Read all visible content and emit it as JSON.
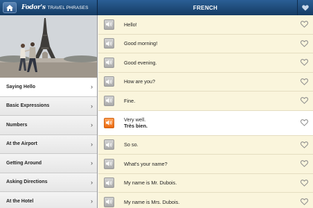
{
  "header": {
    "brand_logo": "Fodor's",
    "brand_sub": "TRAVEL PHRASES",
    "title": "FRENCH",
    "home_icon": "home-icon",
    "favorites_icon": "heart-icon"
  },
  "sidebar": {
    "categories": [
      {
        "label": "Saying Hello",
        "active": true
      },
      {
        "label": "Basic Expressions",
        "active": false
      },
      {
        "label": "Numbers",
        "active": false
      },
      {
        "label": "At the Airport",
        "active": false
      },
      {
        "label": "Getting Around",
        "active": false
      },
      {
        "label": "Asking Directions",
        "active": false
      },
      {
        "label": "At the Hotel",
        "active": false
      }
    ]
  },
  "phrases": [
    {
      "text": "Hello!",
      "translation": ""
    },
    {
      "text": "Good morning!",
      "translation": ""
    },
    {
      "text": "Good evening.",
      "translation": ""
    },
    {
      "text": "How are you?",
      "translation": ""
    },
    {
      "text": "Fine.",
      "translation": ""
    },
    {
      "text": "Very well.",
      "translation": "Très bien."
    },
    {
      "text": "So so.",
      "translation": ""
    },
    {
      "text": "What's your name?",
      "translation": ""
    },
    {
      "text": "My name is Mr. Dubois.",
      "translation": ""
    },
    {
      "text": "My name is Mrs. Dubois.",
      "translation": ""
    }
  ],
  "selected_phrase_index": 5,
  "colors": {
    "header": "#1f4d7e",
    "accent_speaker": "#f07a20",
    "phrase_bg": "#faf5dc"
  }
}
